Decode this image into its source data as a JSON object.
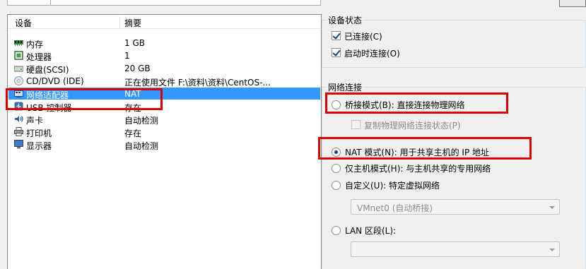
{
  "device_list": {
    "headers": {
      "device": "设备",
      "summary": "摘要"
    },
    "rows": [
      {
        "name": "内存",
        "summary": "1 GB",
        "icon": "memory-icon"
      },
      {
        "name": "处理器",
        "summary": "1",
        "icon": "cpu-icon"
      },
      {
        "name": "硬盘(SCSI)",
        "summary": "20 GB",
        "icon": "harddisk-icon"
      },
      {
        "name": "CD/DVD (IDE)",
        "summary": "正在使用文件 F:\\资料\\资料\\CentOS-...",
        "icon": "cd-dvd-icon"
      },
      {
        "name": "网络适配器",
        "summary": "NAT",
        "icon": "network-adapter-icon",
        "selected": true
      },
      {
        "name": "USB 控制器",
        "summary": "存在",
        "icon": "usb-icon"
      },
      {
        "name": "声卡",
        "summary": "自动检测",
        "icon": "sound-icon"
      },
      {
        "name": "打印机",
        "summary": "存在",
        "icon": "printer-icon"
      },
      {
        "name": "显示器",
        "summary": "自动检测",
        "icon": "display-icon"
      }
    ]
  },
  "device_status": {
    "title": "设备状态",
    "connected": {
      "label": "已连接(C)",
      "checked": true
    },
    "connect_at_power_on": {
      "label": "启动时连接(O)",
      "checked": true
    }
  },
  "network_connection": {
    "title": "网络连接",
    "bridged": {
      "label": "桥接模式(B): 直接连接物理网络",
      "checked": false
    },
    "replicate": {
      "label": "复制物理网络连接状态(P)",
      "checked": false,
      "disabled": true
    },
    "nat": {
      "label": "NAT 模式(N): 用于共享主机的 IP 地址",
      "checked": true
    },
    "host_only": {
      "label": "仅主机模式(H): 与主机共享的专用网络",
      "checked": false
    },
    "custom": {
      "label": "自定义(U): 特定虚拟网络",
      "checked": false
    },
    "custom_select": {
      "value": "VMnet0 (自动桥接)"
    },
    "lan_segment": {
      "label": "LAN 区段(L):",
      "checked": false
    },
    "lan_select": {
      "value": ""
    }
  },
  "colors": {
    "selection": "#3399ff",
    "highlight": "#e00000"
  }
}
